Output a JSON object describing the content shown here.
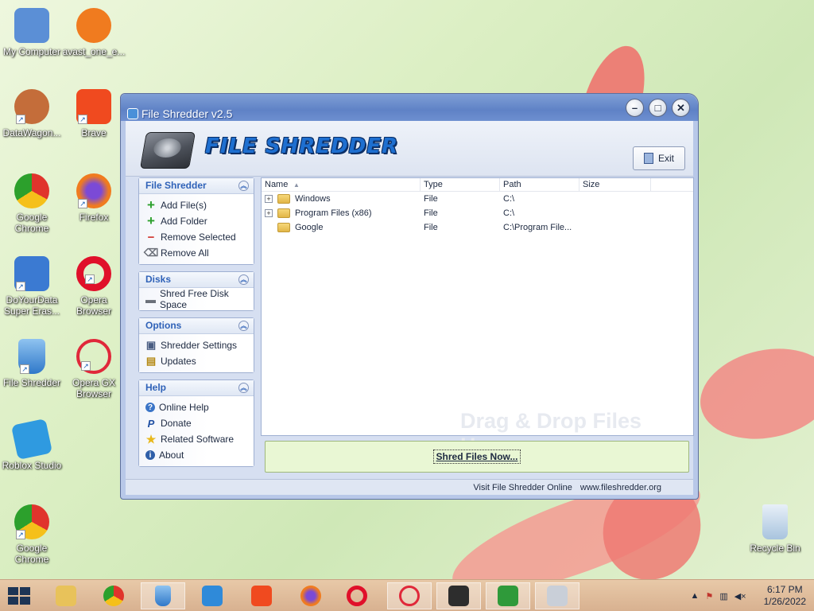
{
  "desktop": {
    "icons": [
      {
        "label": "My Computer",
        "icon": "computer-icon",
        "color": "#5b8fd6"
      },
      {
        "label": "avast_one_e...",
        "icon": "avast-icon",
        "color": "#f07b1f"
      },
      {
        "label": "DataWagon...",
        "icon": "datawagon-icon",
        "color": "#c46d3a"
      },
      {
        "label": "Brave",
        "icon": "brave-icon",
        "color": "#f04a1f"
      },
      {
        "label": "Google Chrome",
        "icon": "chrome-icon",
        "color": "#4a8ef0"
      },
      {
        "label": "Firefox",
        "icon": "firefox-icon",
        "color": "#f07b1f"
      },
      {
        "label": "DoYourData Super Eras...",
        "icon": "doyourdata-icon",
        "color": "#3b7ad2"
      },
      {
        "label": "Opera Browser",
        "icon": "opera-icon",
        "color": "#e0102a"
      },
      {
        "label": "File Shredder",
        "icon": "file-shredder-icon",
        "color": "#3b8ad9"
      },
      {
        "label": "Opera GX Browser",
        "icon": "opera-gx-icon",
        "color": "#e0283a"
      },
      {
        "label": "Roblox Studio",
        "icon": "roblox-studio-icon",
        "color": "#2f9ae0"
      },
      {
        "label": "Google Chrome",
        "icon": "chrome-icon",
        "color": "#4a8ef0"
      },
      {
        "label": "Recycle Bin",
        "icon": "recycle-bin-icon",
        "color": "#a8c4de"
      }
    ]
  },
  "window": {
    "title": "File Shredder v2.5",
    "logo_text": "FILE SHREDDER",
    "exit_label": "Exit",
    "caption_buttons": {
      "minimize": "–",
      "maximize": "□",
      "close": "✕"
    }
  },
  "sidebar": {
    "groups": [
      {
        "title": "File Shredder",
        "items": [
          {
            "label": "Add File(s)",
            "icon": "plus-icon"
          },
          {
            "label": "Add Folder",
            "icon": "plus-icon"
          },
          {
            "label": "Remove Selected",
            "icon": "minus-icon"
          },
          {
            "label": "Remove All",
            "icon": "eraser-icon"
          }
        ]
      },
      {
        "title": "Disks",
        "items": [
          {
            "label": "Shred Free Disk Space",
            "icon": "disk-icon"
          }
        ]
      },
      {
        "title": "Options",
        "items": [
          {
            "label": "Shredder Settings",
            "icon": "settings-icon"
          },
          {
            "label": "Updates",
            "icon": "updates-icon"
          }
        ]
      },
      {
        "title": "Help",
        "items": [
          {
            "label": "Online Help",
            "icon": "help-icon"
          },
          {
            "label": "Donate",
            "icon": "paypal-icon"
          },
          {
            "label": "Related Software",
            "icon": "star-icon"
          },
          {
            "label": "About",
            "icon": "info-icon"
          }
        ]
      }
    ]
  },
  "file_list": {
    "columns": [
      "Name",
      "Type",
      "Path",
      "Size"
    ],
    "rows": [
      {
        "name": "Windows",
        "type": "File",
        "path": "C:\\",
        "size": "",
        "expandable": true
      },
      {
        "name": "Program Files (x86)",
        "type": "File",
        "path": "C:\\",
        "size": "",
        "expandable": true
      },
      {
        "name": "Google",
        "type": "File",
        "path": "C:\\Program File...",
        "size": "",
        "expandable": false
      }
    ],
    "drop_hint": "Drag & Drop Files Here"
  },
  "shred_button": "Shred Files Now...",
  "status": {
    "visit_text": "Visit File Shredder Online",
    "url": "www.fileshredder.org"
  },
  "taskbar": {
    "items": [
      {
        "icon": "file-explorer-icon",
        "color": "#e8c25a"
      },
      {
        "icon": "chrome-icon",
        "color": "#4a8ef0"
      },
      {
        "icon": "file-shredder-icon",
        "color": "#3b8ad9",
        "active": true
      },
      {
        "icon": "weather-icon",
        "color": "#2f8ad9"
      },
      {
        "icon": "brave-icon",
        "color": "#f04a1f"
      },
      {
        "icon": "firefox-icon",
        "color": "#f07b1f"
      },
      {
        "icon": "opera-icon",
        "color": "#e0102a"
      },
      {
        "icon": "opera-gx-icon",
        "color": "#e0283a"
      },
      {
        "icon": "roblox-studio-icon",
        "color": "#2d2d2d"
      },
      {
        "icon": "store-icon",
        "color": "#2f9a3a"
      },
      {
        "icon": "monitor-icon",
        "color": "#c9cfd8"
      }
    ],
    "clock_time": "6:17 PM",
    "clock_date": "1/26/2022"
  }
}
